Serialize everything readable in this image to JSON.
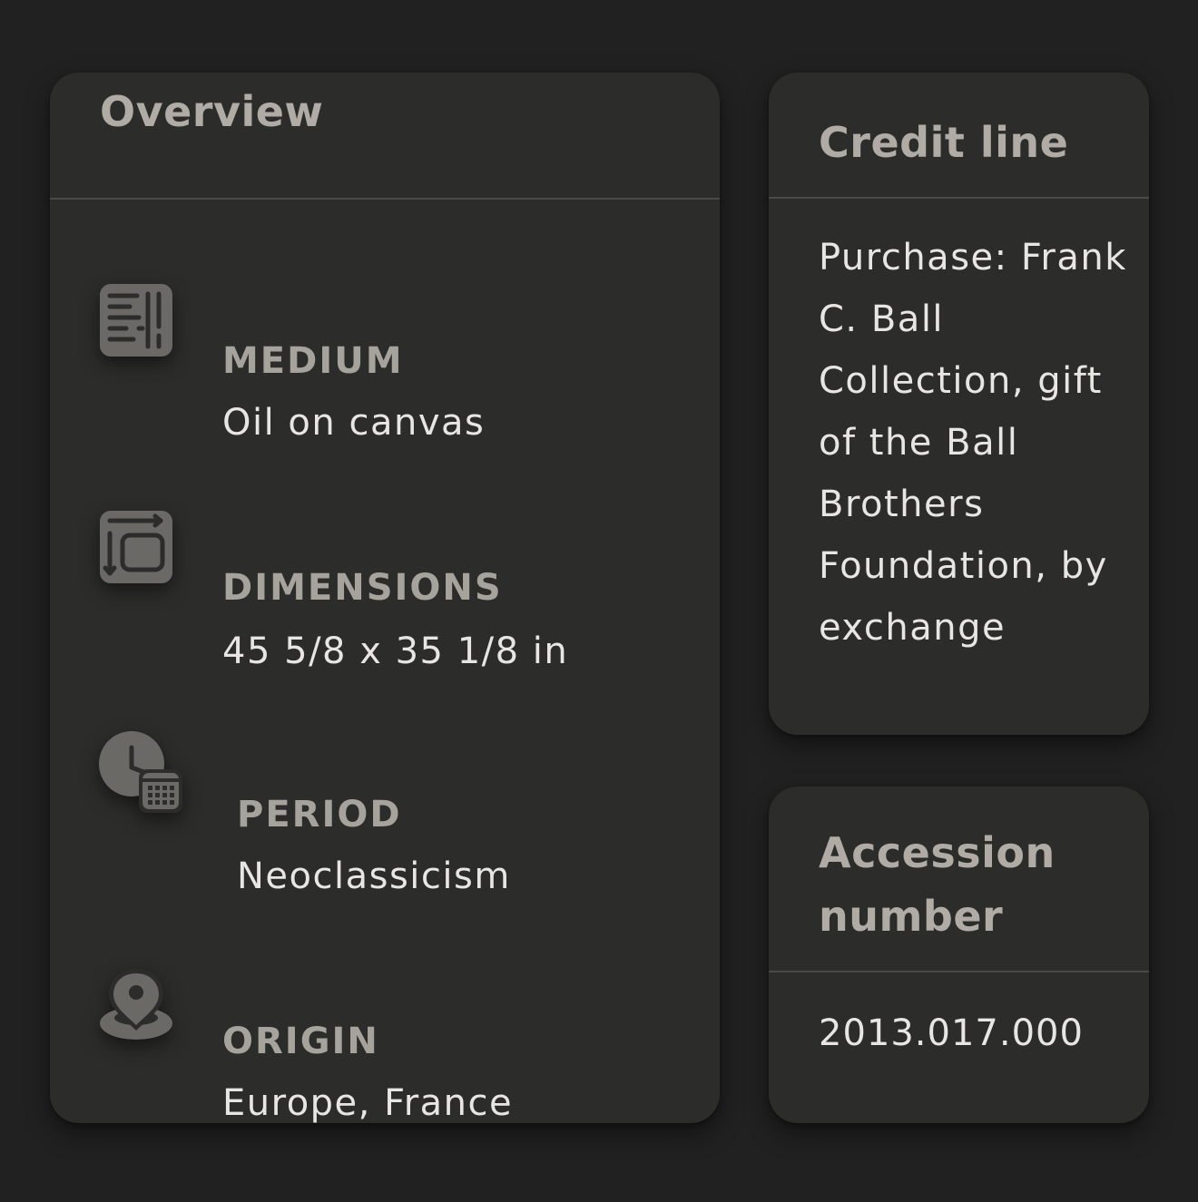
{
  "overview": {
    "title": "Overview",
    "items": [
      {
        "label": "MEDIUM",
        "value": "Oil on canvas",
        "icon": "texture-icon"
      },
      {
        "label": "DIMENSIONS",
        "value": "45 5/8 x 35 1/8 in",
        "icon": "dimensions-icon"
      },
      {
        "label": "PERIOD",
        "value": "Neoclassicism",
        "icon": "clock-calendar-icon"
      },
      {
        "label": "ORIGIN",
        "value": "Europe, France",
        "icon": "location-pin-icon"
      }
    ]
  },
  "credit_line": {
    "title": "Credit line",
    "text": "Purchase: Frank C. Ball Collection, gift of the Ball Brothers Foundation, by exchange"
  },
  "accession": {
    "title": "Accession number",
    "number": "2013.017.000"
  },
  "colors": {
    "background": "#212121",
    "card": "#2c2c2b",
    "title": "#b0aca5",
    "label": "#a6a29c",
    "value": "#e8e6e2",
    "icon": "#6e6c69"
  }
}
